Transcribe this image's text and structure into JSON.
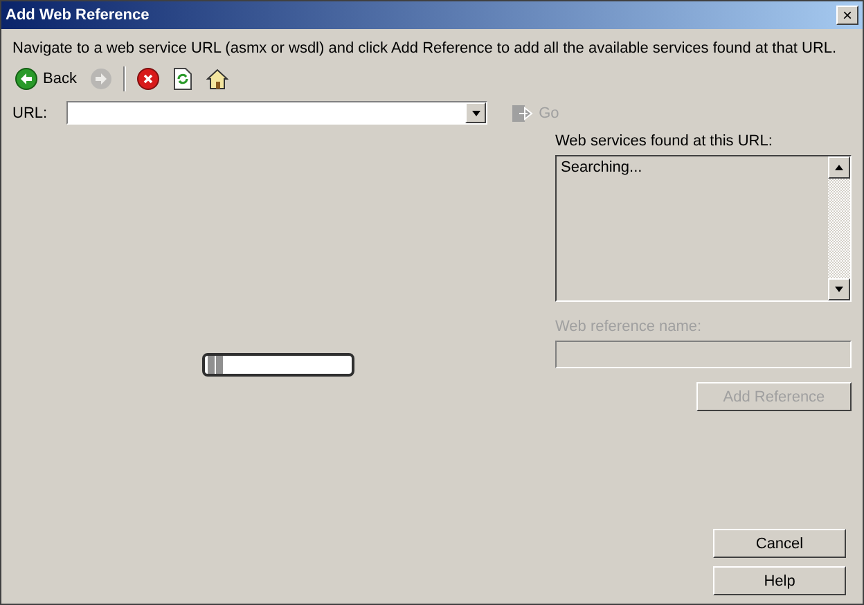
{
  "window": {
    "title": "Add Web Reference",
    "close": "×"
  },
  "instructions": "Navigate to a web service URL (asmx or wsdl) and click Add Reference to add all the available services found at that URL.",
  "toolbar": [
    {
      "kind": "back",
      "label": "Back",
      "disabled": false
    },
    {
      "kind": "forward",
      "disabled": true
    },
    {
      "kind": "separator"
    },
    {
      "kind": "stop",
      "disabled": false
    },
    {
      "kind": "refresh",
      "disabled": false
    },
    {
      "kind": "home",
      "disabled": false
    }
  ],
  "url": {
    "label": "URL:",
    "go": {
      "label": "Go",
      "disabled": true
    }
  },
  "browser": {
    "progress": {
      "level": 0.1
    }
  },
  "services": {
    "label": "Web services found at this URL:",
    "items": [
      "Searching..."
    ]
  },
  "reference_name": {
    "label": "Web reference name:",
    "disabled": true
  },
  "add_reference": {
    "label": "Add Reference",
    "disabled": true
  },
  "buttons": [
    "Cancel",
    "Help"
  ]
}
